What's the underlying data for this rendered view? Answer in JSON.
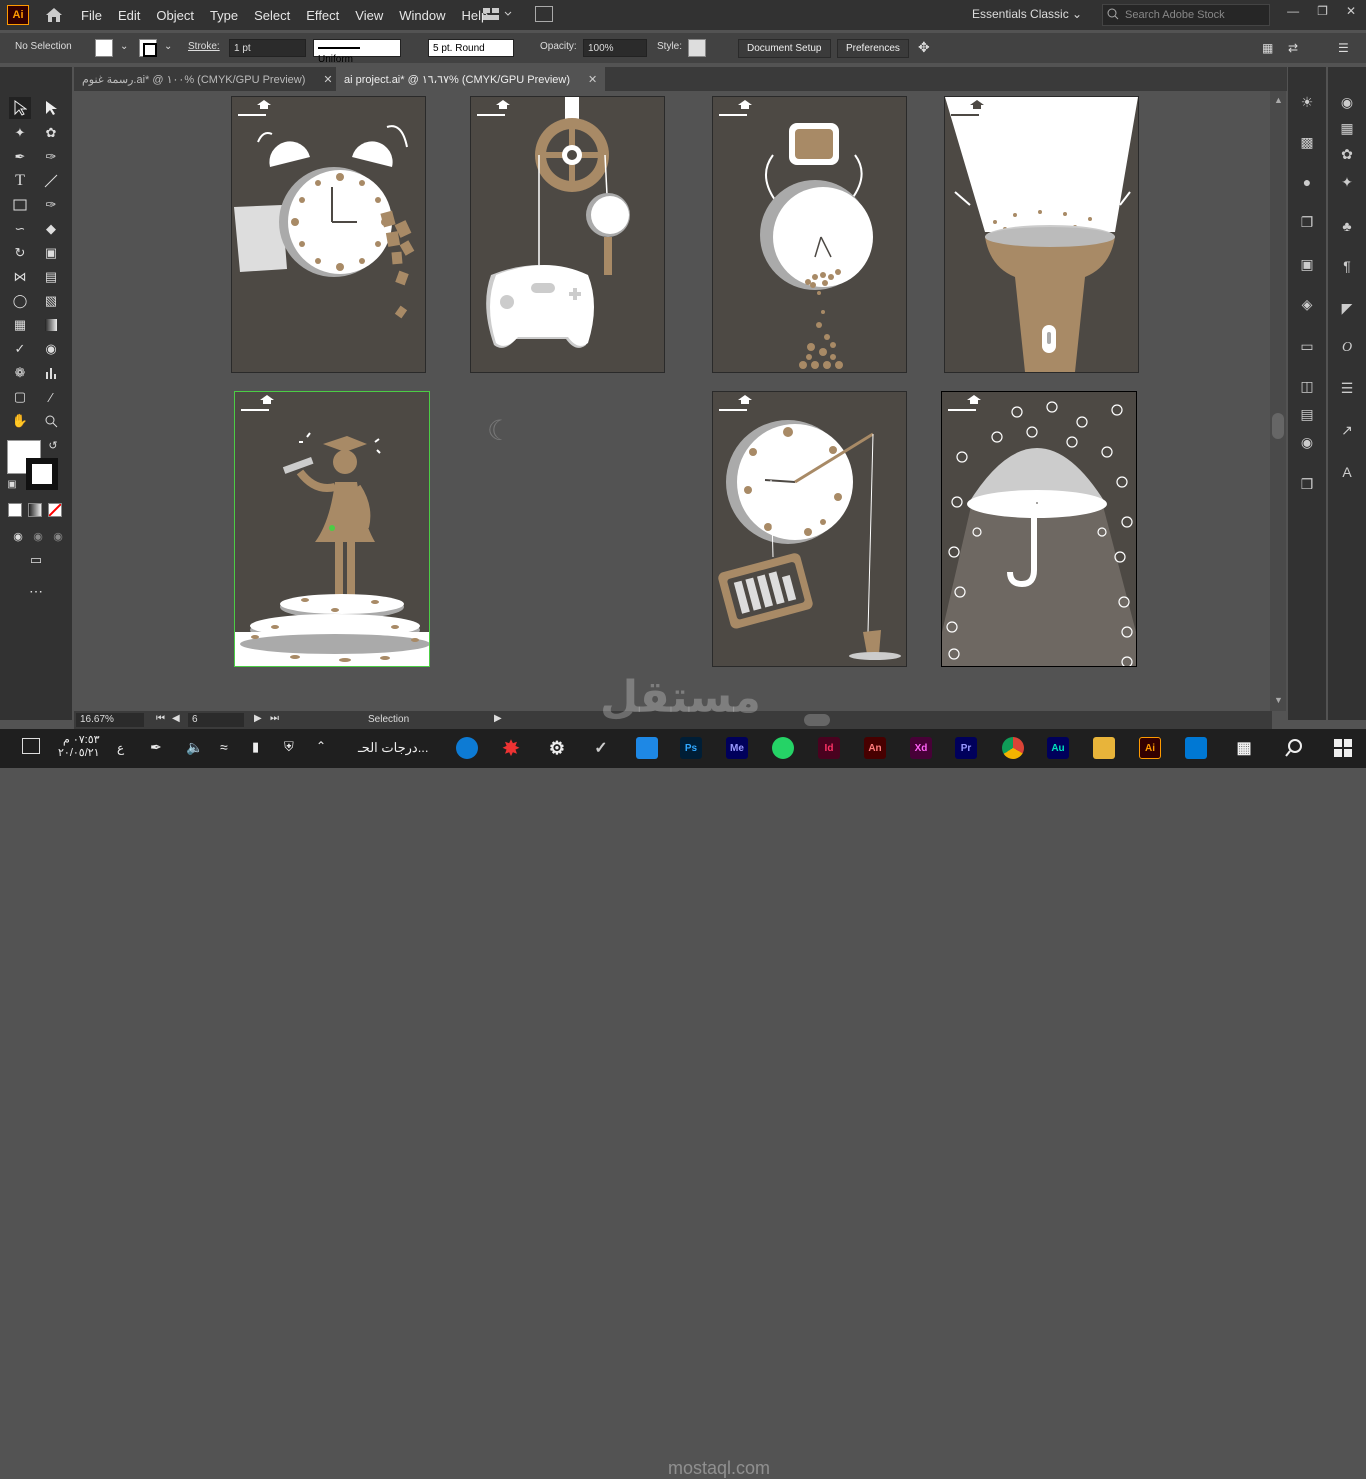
{
  "menubar": {
    "logo": "Ai",
    "items": [
      "File",
      "Edit",
      "Object",
      "Type",
      "Select",
      "Effect",
      "View",
      "Window",
      "Help"
    ],
    "workspace": "Essentials Classic",
    "search_placeholder": "Search Adobe Stock"
  },
  "control_bar": {
    "selection": "No Selection",
    "stroke_label": "Stroke:",
    "stroke_weight": "1 pt",
    "stroke_profile": "Uniform",
    "brush": "5 pt. Round",
    "opacity_label": "Opacity:",
    "opacity": "100%",
    "style_label": "Style:",
    "document_setup": "Document Setup",
    "preferences": "Preferences"
  },
  "tabs": [
    {
      "label": "رسمة غنوم.ai* @ ١٠٠% (CMYK/GPU Preview)"
    },
    {
      "label": "ai project.ai* @ ١٦،٦٧% (CMYK/GPU Preview)"
    }
  ],
  "status": {
    "zoom": "16.67%",
    "artboard": "6",
    "mode": "Selection"
  },
  "taskbar": {
    "time": "٠٧:٥٣ م",
    "date": "٢٠/٠٥/٢١",
    "lang": "ع",
    "search_label": "درجات الحـ...",
    "apps": [
      "Ps",
      "Me",
      "Id",
      "An",
      "Xd",
      "Pr",
      "Au",
      "Ai"
    ]
  },
  "watermark": {
    "text": "مستقل",
    "sub": "mostaql.com"
  },
  "colors": {
    "accent": "#ff9a00",
    "brown": "#a88a66",
    "artboard": "#4d4944"
  }
}
